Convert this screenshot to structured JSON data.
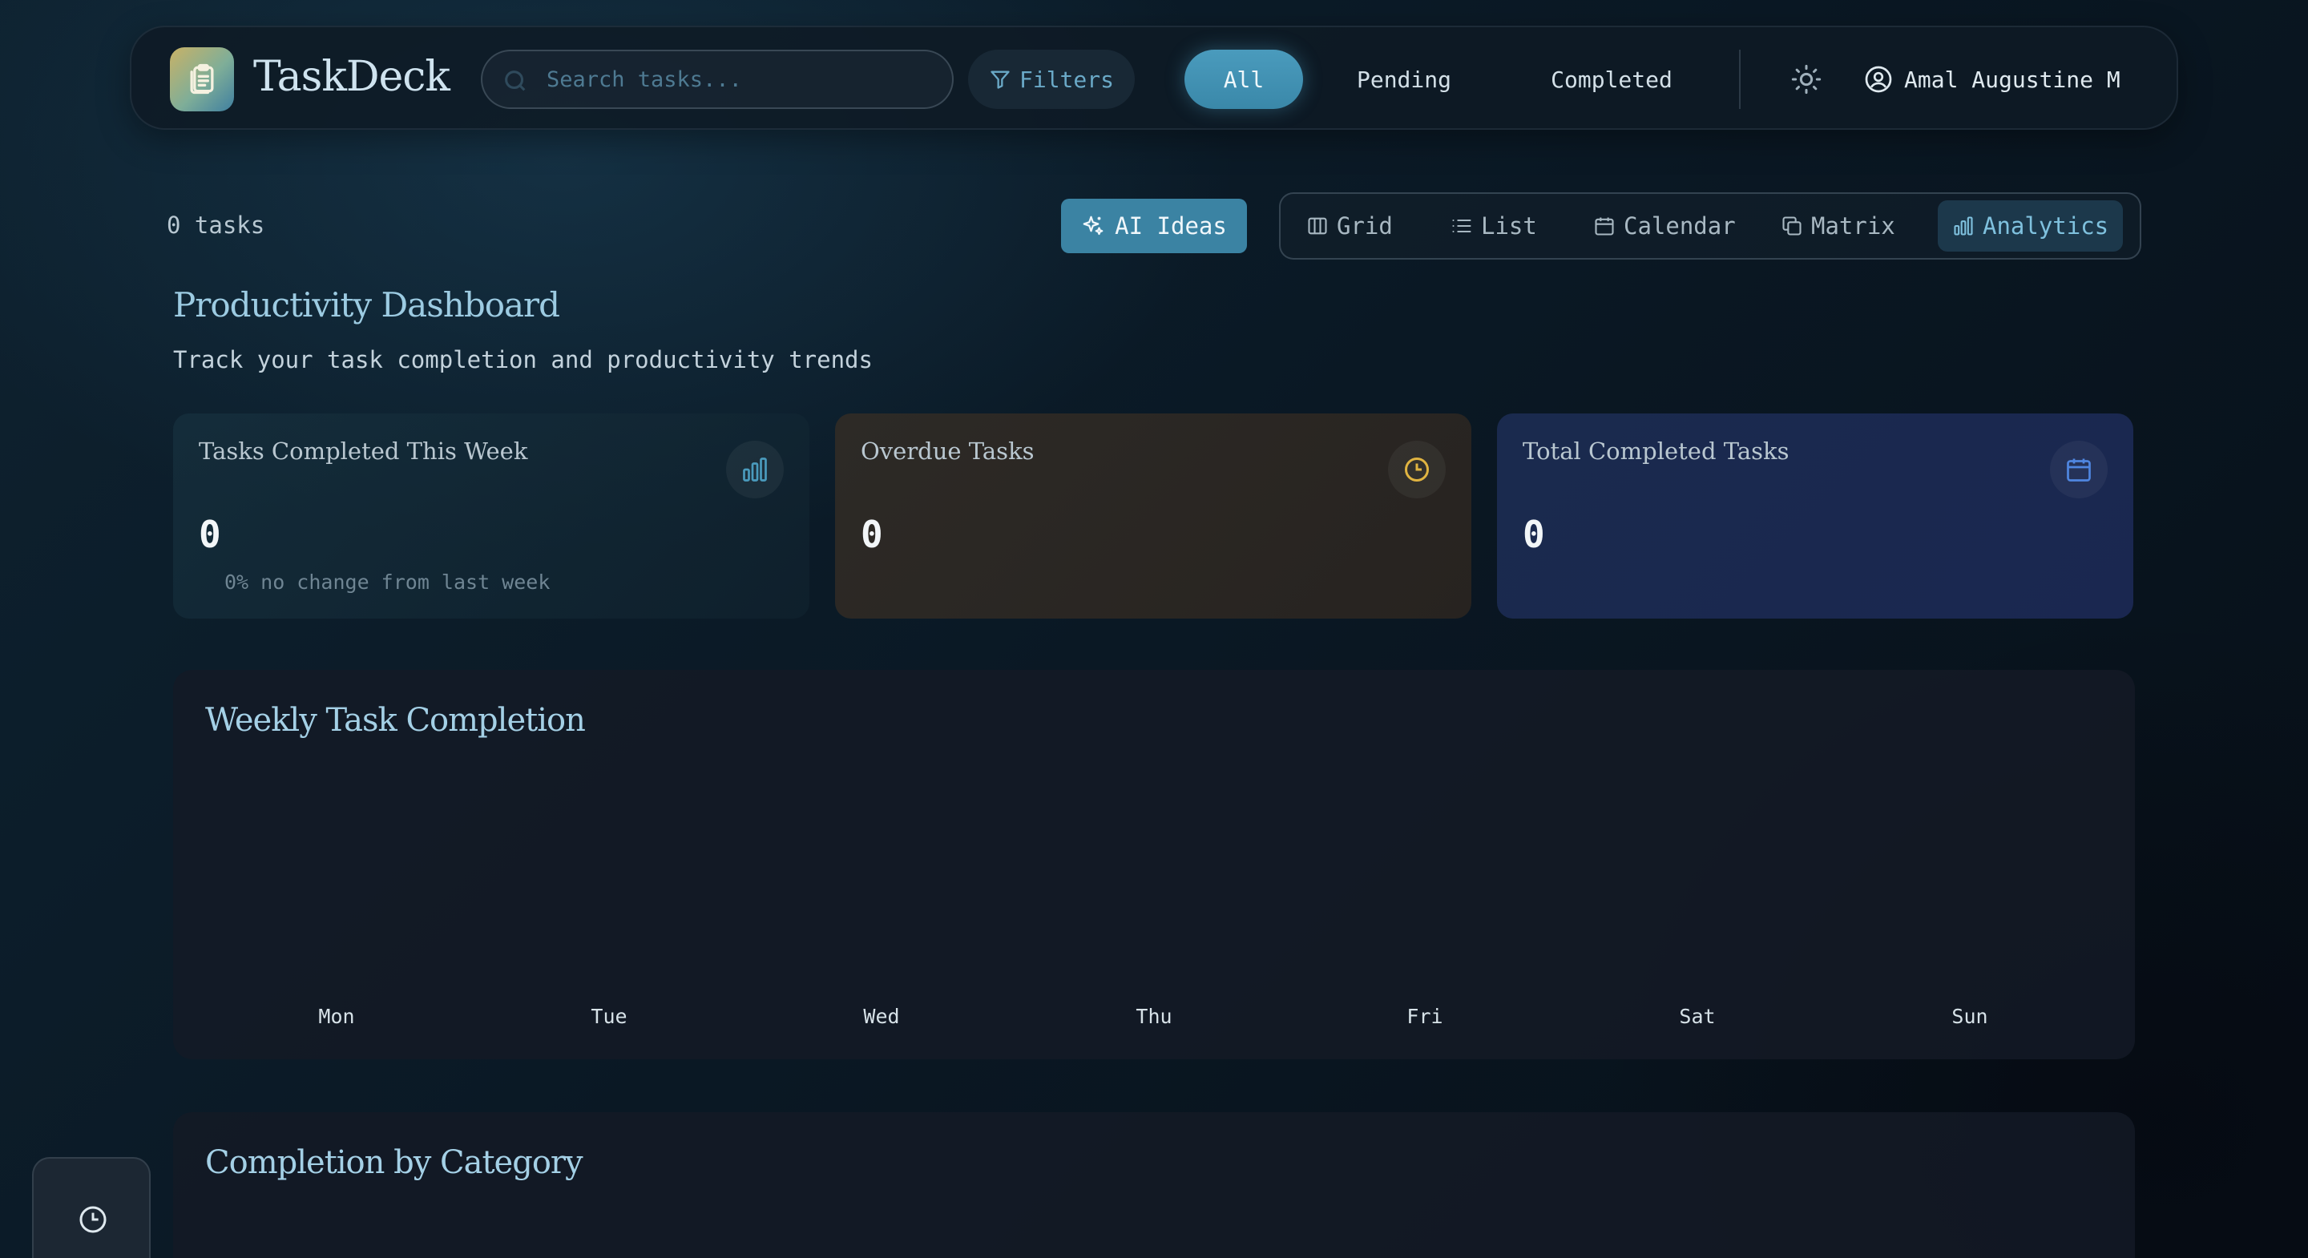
{
  "app": {
    "title": "TaskDeck"
  },
  "search": {
    "placeholder": "Search tasks..."
  },
  "header": {
    "filters_label": "Filters",
    "status_tabs": [
      {
        "label": "All",
        "active": true
      },
      {
        "label": "Pending",
        "active": false
      },
      {
        "label": "Completed",
        "active": false
      }
    ],
    "user_name": "Amal Augustine M"
  },
  "toolbar": {
    "task_count": "0 tasks",
    "ai_ideas_label": "AI Ideas",
    "views": [
      {
        "label": "Grid",
        "icon": "columns-icon",
        "active": false
      },
      {
        "label": "List",
        "icon": "list-icon",
        "active": false
      },
      {
        "label": "Calendar",
        "icon": "calendar-icon",
        "active": false
      },
      {
        "label": "Matrix",
        "icon": "copy-icon",
        "active": false
      },
      {
        "label": "Analytics",
        "icon": "bar-chart-icon",
        "active": true
      }
    ]
  },
  "dashboard": {
    "title": "Productivity Dashboard",
    "subtitle": "Track your task completion and productivity trends",
    "stats": [
      {
        "label": "Tasks Completed This Week",
        "value": "0",
        "note": "0% no change from last week",
        "icon": "bar-chart-icon",
        "accent": "#4a9bbd"
      },
      {
        "label": "Overdue Tasks",
        "value": "0",
        "note": "",
        "icon": "clock-icon",
        "accent": "#e0b441"
      },
      {
        "label": "Total Completed Tasks",
        "value": "0",
        "note": "",
        "icon": "calendar-icon",
        "accent": "#4f86e0"
      }
    ]
  },
  "weekly": {
    "title": "Weekly Task Completion",
    "days": [
      "Mon",
      "Tue",
      "Wed",
      "Thu",
      "Fri",
      "Sat",
      "Sun"
    ]
  },
  "category": {
    "title": "Completion by Category"
  },
  "colors": {
    "accent": "#3b83a3",
    "active_tab": "#4a9bbd",
    "overdue": "#e0b441",
    "total": "#4f86e0"
  }
}
